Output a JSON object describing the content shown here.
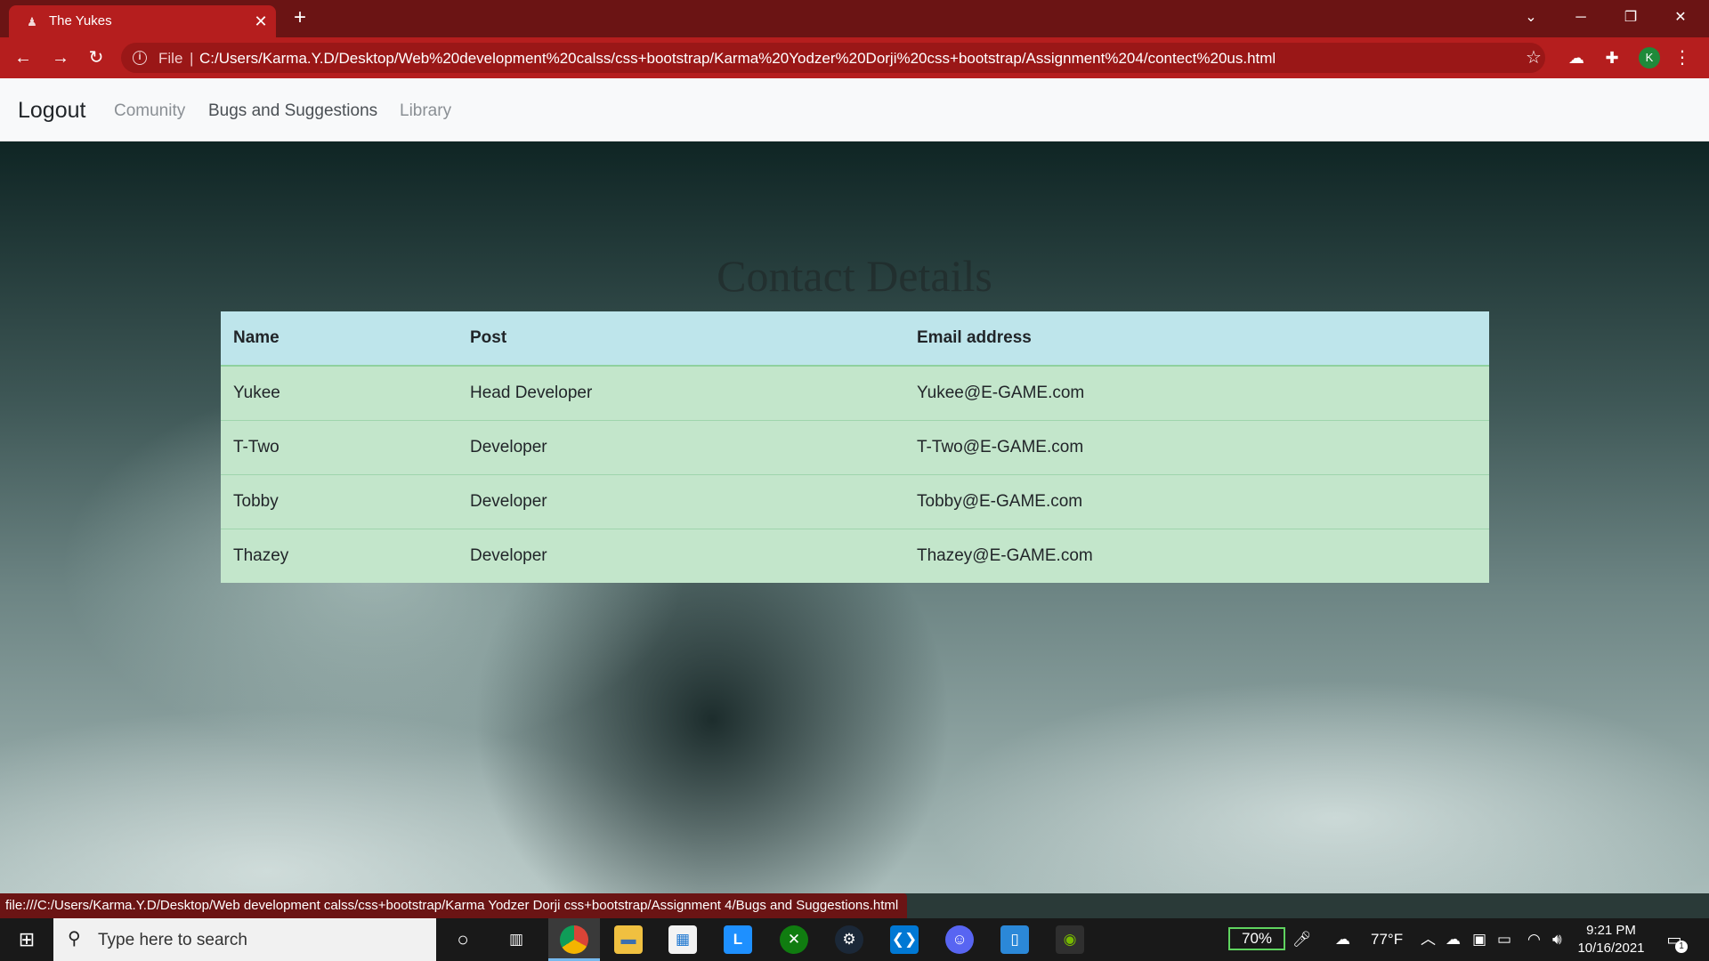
{
  "browser": {
    "tab_title": "The Yukes",
    "tab_favicon": "person-icon",
    "new_tab": "+",
    "scheme": "File",
    "separator": "|",
    "url": "C:/Users/Karma.Y.D/Desktop/Web%20development%20calss/css+bootstrap/Karma%20Yodzer%20Dorji%20css+bootstrap/Assignment%204/contect%20us.html",
    "profile_initial": "K",
    "theme_color": "#b51e1e"
  },
  "navbar": {
    "brand": "Logout",
    "links": [
      "Comunity",
      "Bugs and Suggestions",
      "Library"
    ],
    "link_colors": [
      "#8a8f94",
      "#4a4f54",
      "#8a8f94"
    ]
  },
  "main": {
    "heading": "Contact Details",
    "table": {
      "headers": [
        "Name",
        "Post",
        "Email address"
      ],
      "rows": [
        [
          "Yukee",
          "Head Developer",
          "Yukee@E-GAME.com"
        ],
        [
          "T-Two",
          "Developer",
          "T-Two@E-GAME.com"
        ],
        [
          "Tobby",
          "Developer",
          "Tobby@E-GAME.com"
        ],
        [
          "Thazey",
          "Developer",
          "Thazey@E-GAME.com"
        ]
      ],
      "header_color": "#bee5eb",
      "row_color": "#c3e6cb"
    }
  },
  "status_bar": {
    "link_preview": "file:///C:/Users/Karma.Y.D/Desktop/Web development calss/css+bootstrap/Karma Yodzer Dorji css+bootstrap/Assignment 4/Bugs and Suggestions.html"
  },
  "taskbar": {
    "search_placeholder": "Type here to search",
    "battery": "70%",
    "temperature": "77°F",
    "time": "9:21 PM",
    "date": "10/16/2021",
    "notification_count": "1",
    "apps": [
      "cortana-icon",
      "task-view-icon",
      "chrome-icon",
      "file-explorer-icon",
      "store-icon",
      "launcher-icon",
      "xbox-icon",
      "steam-icon",
      "vscode-icon",
      "discord-icon",
      "files-icon",
      "nvidia-icon"
    ]
  }
}
